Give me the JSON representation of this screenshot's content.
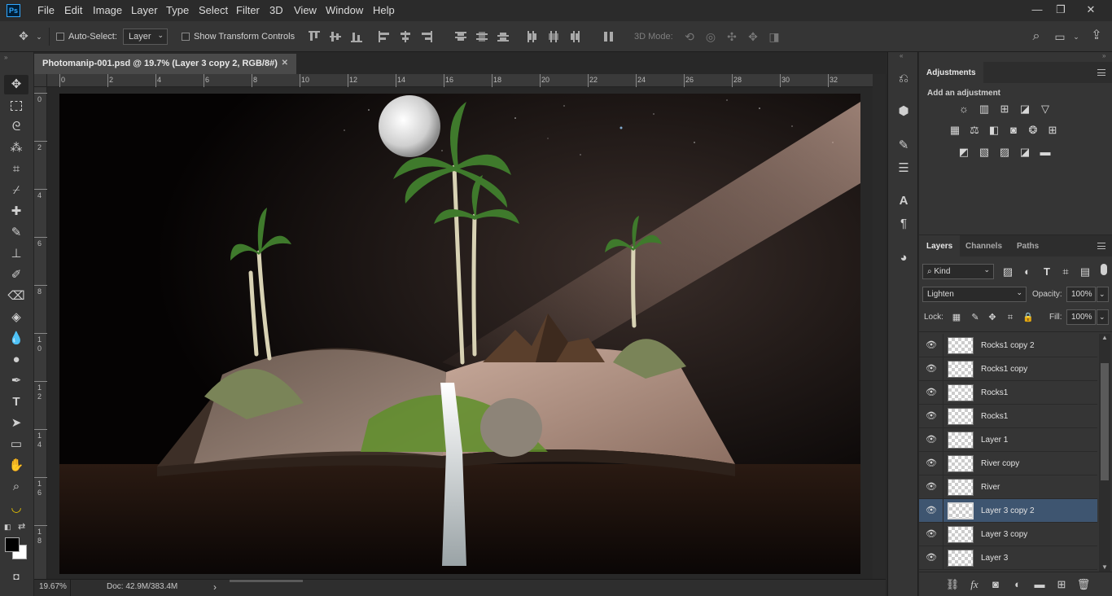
{
  "app": {
    "logo": "Ps"
  },
  "menu": [
    "File",
    "Edit",
    "Image",
    "Layer",
    "Type",
    "Select",
    "Filter",
    "3D",
    "View",
    "Window",
    "Help"
  ],
  "window_controls": {
    "minimize": "—",
    "restore": "❐",
    "close": "✕"
  },
  "options_bar": {
    "auto_select_label": "Auto-Select:",
    "auto_select_target": "Layer",
    "transform_controls_label": "Show Transform Controls",
    "mode_3d_label": "3D Mode:"
  },
  "document": {
    "tab_title": "Photomanip-001.psd @ 19.7% (Layer 3 copy 2, RGB/8#)",
    "tab_close": "✕"
  },
  "ruler": {
    "top_ticks": [
      "0",
      "2",
      "4",
      "6",
      "8",
      "10",
      "12",
      "14",
      "16",
      "18",
      "20",
      "22",
      "24",
      "26",
      "28",
      "30",
      "32"
    ],
    "left_ticks": [
      [
        "0"
      ],
      [
        "2"
      ],
      [
        "4"
      ],
      [
        "6"
      ],
      [
        "8"
      ],
      [
        "1",
        "0"
      ],
      [
        "1",
        "2"
      ],
      [
        "1",
        "4"
      ],
      [
        "1",
        "6"
      ],
      [
        "1",
        "8"
      ]
    ]
  },
  "status": {
    "zoom": "19.67%",
    "doc_size": "Doc: 42.9M/383.4M",
    "arrow": "›"
  },
  "adjustments": {
    "tab_label": "Adjustments",
    "subtitle": "Add an adjustment"
  },
  "layers_panel": {
    "tabs": [
      "Layers",
      "Channels",
      "Paths"
    ],
    "filter_kind": "Kind",
    "blend_mode": "Lighten",
    "opacity_label": "Opacity:",
    "opacity_value": "100%",
    "lock_label": "Lock:",
    "fill_label": "Fill:",
    "fill_value": "100%",
    "layers": [
      {
        "name": "Rocks1 copy 2",
        "visible": true,
        "selected": false
      },
      {
        "name": "Rocks1 copy",
        "visible": true,
        "selected": false
      },
      {
        "name": "Rocks1",
        "visible": true,
        "selected": false
      },
      {
        "name": "Rocks1",
        "visible": true,
        "selected": false
      },
      {
        "name": "Layer 1",
        "visible": true,
        "selected": false
      },
      {
        "name": "River copy",
        "visible": true,
        "selected": false
      },
      {
        "name": "River",
        "visible": true,
        "selected": false
      },
      {
        "name": "Layer 3 copy 2",
        "visible": true,
        "selected": true
      },
      {
        "name": "Layer 3 copy",
        "visible": true,
        "selected": false
      },
      {
        "name": "Layer 3",
        "visible": true,
        "selected": false
      }
    ]
  },
  "colors": {
    "selection_blue": "#3e5570",
    "logo_blue": "#31a8ff",
    "foreground": "#000000",
    "background": "#ffffff"
  }
}
